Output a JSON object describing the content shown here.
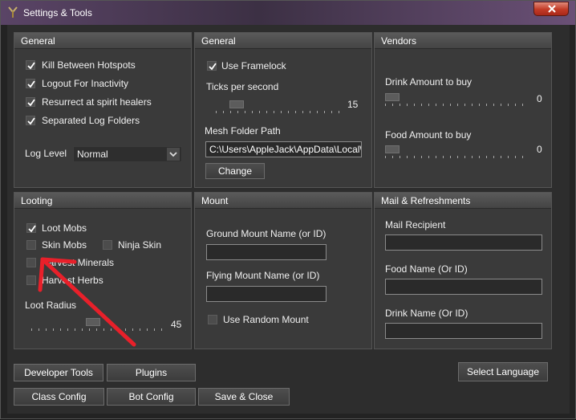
{
  "window": {
    "title": "Settings & Tools"
  },
  "panels": {
    "general1": {
      "title": "General",
      "checkboxes": [
        {
          "label": "Kill Between Hotspots",
          "checked": true
        },
        {
          "label": "Logout For Inactivity",
          "checked": true
        },
        {
          "label": "Resurrect at spirit healers",
          "checked": true
        },
        {
          "label": "Separated Log Folders",
          "checked": true
        }
      ],
      "log_level_label": "Log Level",
      "log_level_value": "Normal"
    },
    "general2": {
      "title": "General",
      "use_framelock": {
        "label": "Use Framelock",
        "checked": true
      },
      "ticks_label": "Ticks per second",
      "ticks_value": "15",
      "ticks_level": 0.12,
      "mesh_label": "Mesh Folder Path",
      "mesh_value": "C:\\Users\\AppleJack\\AppData\\Local\\",
      "change_button": "Change"
    },
    "vendors": {
      "title": "Vendors",
      "drink_label": "Drink Amount to buy",
      "drink_value": "0",
      "food_label": "Food Amount to buy",
      "food_value": "0"
    },
    "looting": {
      "title": "Looting",
      "loot_mobs": {
        "label": "Loot Mobs",
        "checked": true
      },
      "skin_mobs": {
        "label": "Skin Mobs",
        "checked": false
      },
      "ninja_skin": {
        "label": "Ninja Skin",
        "checked": false
      },
      "harvest_minerals": {
        "label": "Harvest Minerals",
        "checked": false
      },
      "harvest_herbs": {
        "label": "Harvest Herbs",
        "checked": false
      },
      "loot_radius_label": "Loot Radius",
      "loot_radius_value": "45",
      "loot_radius_level": 0.45
    },
    "mount": {
      "title": "Mount",
      "ground_label": "Ground Mount Name (or ID)",
      "ground_value": "",
      "flying_label": "Flying Mount Name (or ID)",
      "flying_value": "",
      "random": {
        "label": "Use Random Mount",
        "checked": false
      }
    },
    "mail": {
      "title": "Mail & Refreshments",
      "recipient_label": "Mail Recipient",
      "food_label": "Food Name (Or ID)",
      "drink_label": "Drink Name (Or ID)"
    }
  },
  "buttons": {
    "developer_tools": "Developer Tools",
    "plugins": "Plugins",
    "select_language": "Select Language",
    "class_config": "Class Config",
    "bot_config": "Bot Config",
    "save_close": "Save & Close"
  },
  "colors": {
    "annotation_arrow": "#e8202a"
  }
}
